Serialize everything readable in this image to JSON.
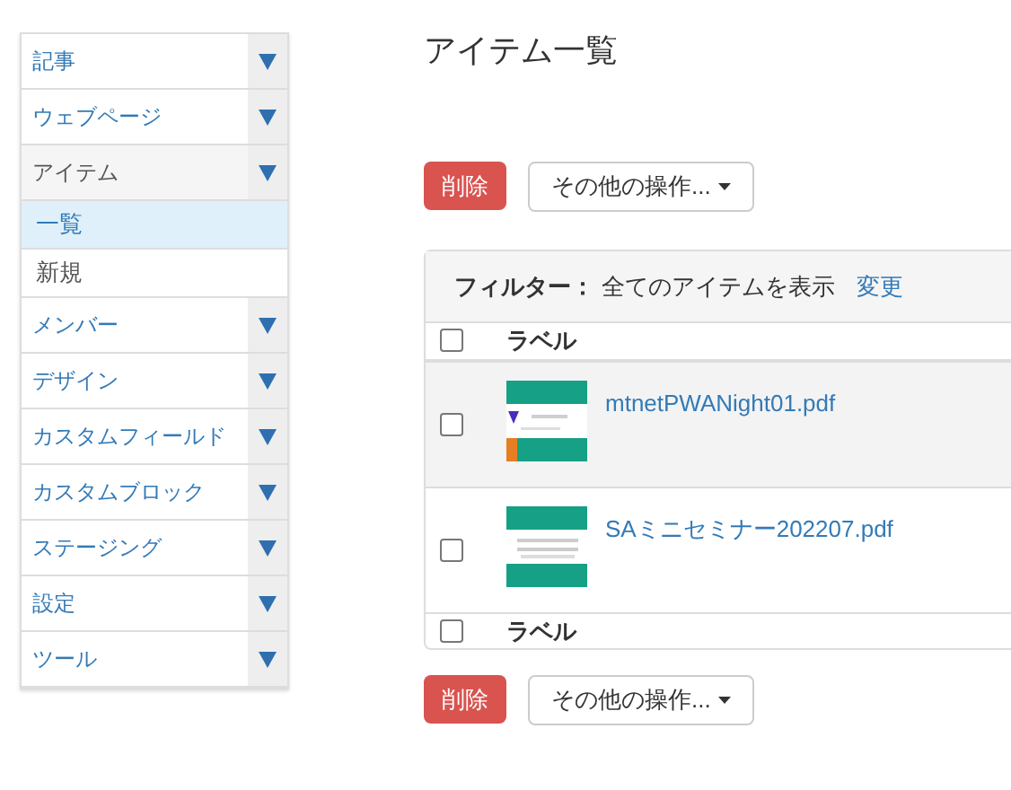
{
  "sidebar": {
    "items": [
      {
        "label": "記事",
        "expanded": false
      },
      {
        "label": "ウェブページ",
        "expanded": false
      },
      {
        "label": "アイテム",
        "expanded": true,
        "children": [
          {
            "label": "一覧",
            "selected": true
          },
          {
            "label": "新規",
            "selected": false
          }
        ]
      },
      {
        "label": "メンバー",
        "expanded": false
      },
      {
        "label": "デザイン",
        "expanded": false
      },
      {
        "label": "カスタムフィールド",
        "expanded": false
      },
      {
        "label": "カスタムブロック",
        "expanded": false
      },
      {
        "label": "ステージング",
        "expanded": false
      },
      {
        "label": "設定",
        "expanded": false
      },
      {
        "label": "ツール",
        "expanded": false
      }
    ]
  },
  "page_title": "アイテム一覧",
  "top_actions": {
    "delete": "削除",
    "more": "その他の操作..."
  },
  "filter": {
    "label": "フィルター：",
    "value": "全てのアイテムを表示",
    "change": "変更"
  },
  "table": {
    "header": {
      "label": "ラベル",
      "checked": false
    },
    "rows": [
      {
        "name": "mtnetPWANight01.pdf",
        "checked": false,
        "highlighted": true
      },
      {
        "name": "SAミニセミナー202207.pdf",
        "checked": false,
        "highlighted": false
      }
    ],
    "footer": {
      "label": "ラベル",
      "checked": false
    }
  },
  "bottom_actions": {
    "delete": "削除",
    "more": "その他の操作..."
  }
}
